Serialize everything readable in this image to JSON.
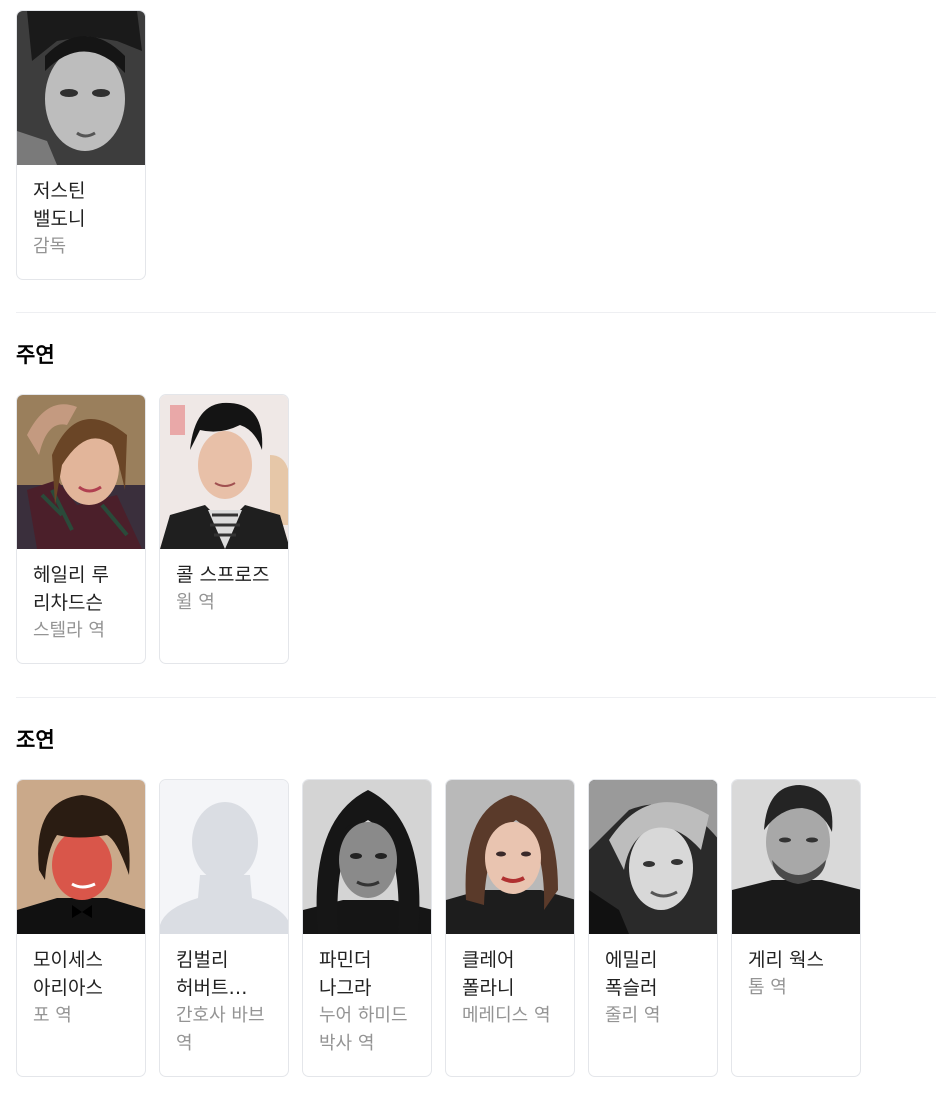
{
  "sections": [
    {
      "title": "",
      "people": [
        {
          "name": "저스틴 밸도니",
          "role": "감독"
        }
      ]
    },
    {
      "title": "주연",
      "people": [
        {
          "name": "헤일리 루 리차드슨",
          "role": "스텔라 역"
        },
        {
          "name": "콜 스프로즈",
          "role": "윌 역"
        }
      ]
    },
    {
      "title": "조연",
      "people": [
        {
          "name": "모이세스 아리아스",
          "role": "포 역"
        },
        {
          "name": "킴벌리 허버트 그레고리",
          "role": "간호사 바브 역"
        },
        {
          "name": "파민더 나그라",
          "role": "누어 하미드 박사 역"
        },
        {
          "name": "클레어 폴라니",
          "role": "메레디스 역"
        },
        {
          "name": "에밀리 폭슬러",
          "role": "줄리 역"
        },
        {
          "name": "게리 웍스",
          "role": "톰 역"
        }
      ]
    }
  ]
}
